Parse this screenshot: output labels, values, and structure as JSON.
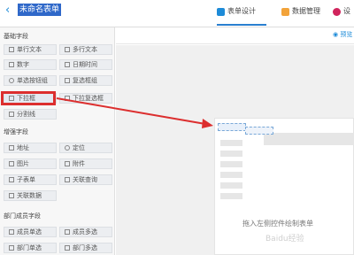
{
  "header": {
    "form_title": "未命名表单",
    "tabs": [
      {
        "label": "表单设计",
        "icon": "form-design-icon",
        "active": true
      },
      {
        "label": "数据管理",
        "icon": "data-manage-icon",
        "active": false
      },
      {
        "label": "设",
        "icon": "settings-icon",
        "active": false
      }
    ],
    "colors": {
      "accent": "#1d8bd8",
      "highlight": "#dc2e2e",
      "title_bg": "#2f68c9"
    }
  },
  "toolbar": {
    "preview_label": "预览"
  },
  "sidebar": {
    "groups": [
      {
        "title": "基础字段",
        "items": [
          {
            "label": "单行文本",
            "icon": "single-line-text-icon"
          },
          {
            "label": "多行文本",
            "icon": "multi-line-text-icon"
          },
          {
            "label": "数字",
            "icon": "number-icon"
          },
          {
            "label": "日期时间",
            "icon": "datetime-icon"
          },
          {
            "label": "单选按钮组",
            "icon": "radio-icon"
          },
          {
            "label": "复选框组",
            "icon": "checkbox-icon"
          },
          {
            "label": "下拉框",
            "icon": "dropdown-icon"
          },
          {
            "label": "下拉复选框",
            "icon": "dropdown-checkbox-icon"
          },
          {
            "label": "分割线",
            "icon": "divider-icon"
          }
        ]
      },
      {
        "title": "增强字段",
        "items": [
          {
            "label": "地址",
            "icon": "address-icon"
          },
          {
            "label": "定位",
            "icon": "location-icon"
          },
          {
            "label": "图片",
            "icon": "image-icon"
          },
          {
            "label": "附件",
            "icon": "attachment-icon"
          },
          {
            "label": "子表单",
            "icon": "subform-icon"
          },
          {
            "label": "关联查询",
            "icon": "link-query-icon"
          },
          {
            "label": "关联数据",
            "icon": "link-data-icon"
          }
        ]
      },
      {
        "title": "部门成员字段",
        "items": [
          {
            "label": "成员单选",
            "icon": "member-single-icon"
          },
          {
            "label": "成员多选",
            "icon": "member-multi-icon"
          },
          {
            "label": "部门单选",
            "icon": "dept-single-icon"
          },
          {
            "label": "部门多选",
            "icon": "dept-multi-icon"
          }
        ]
      }
    ]
  },
  "canvas": {
    "empty_hint": "拖入左侧控件绘制表单",
    "watermark": "Baidu经验"
  }
}
